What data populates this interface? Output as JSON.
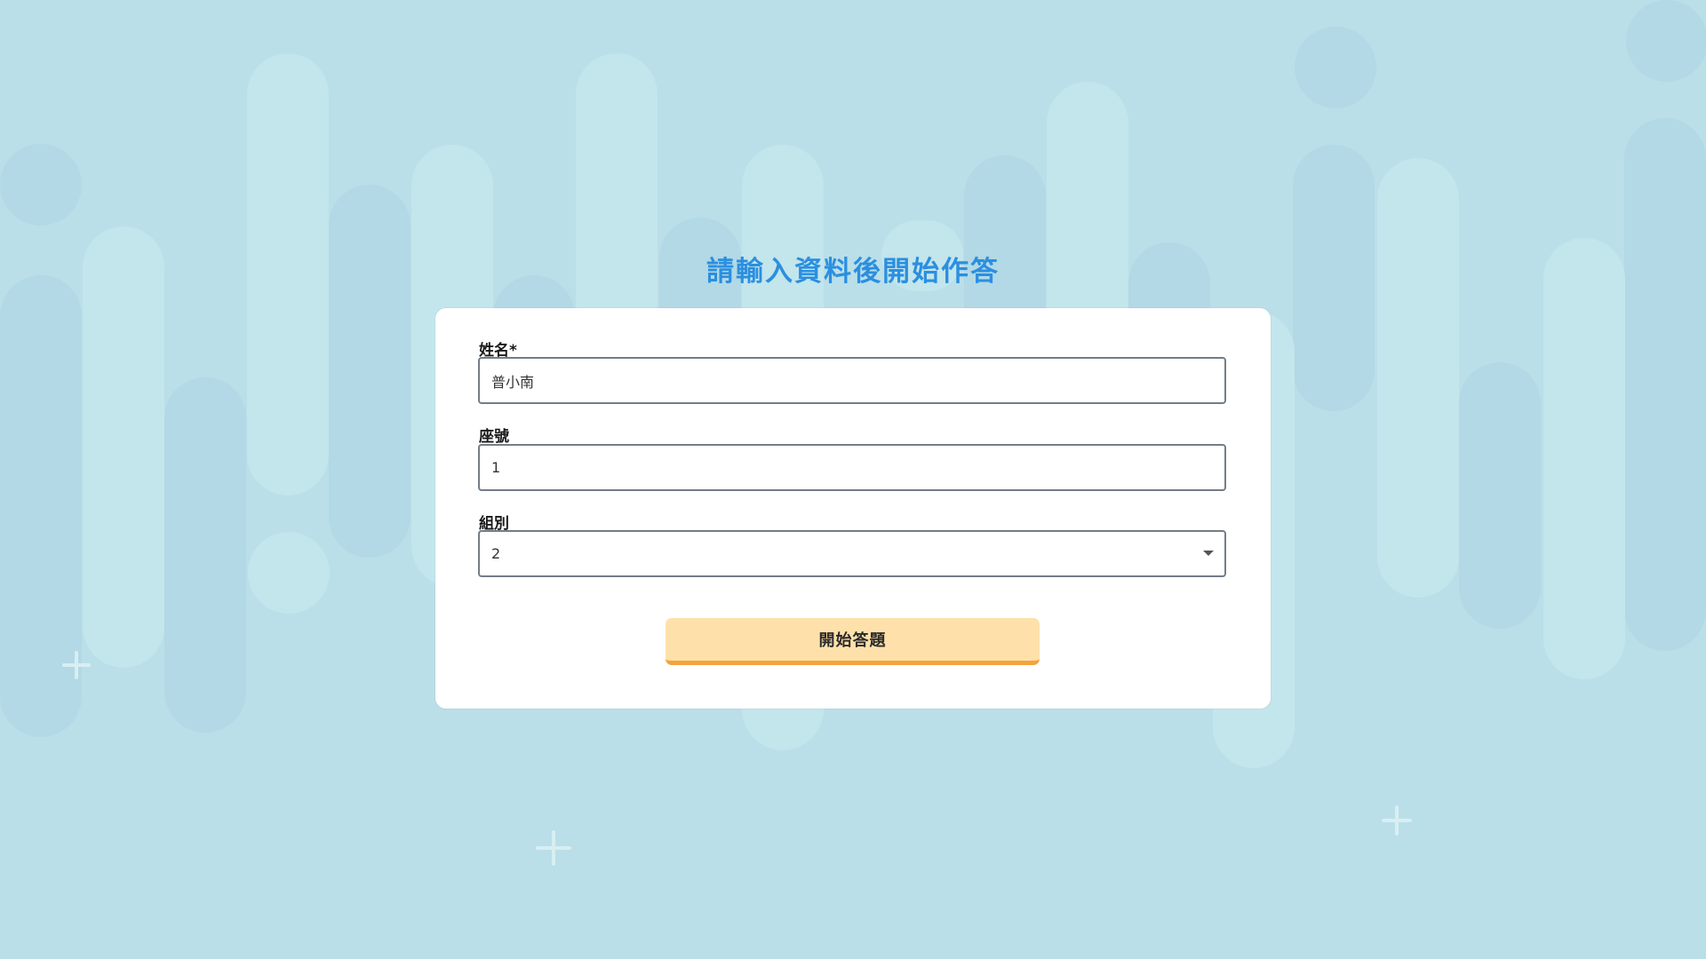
{
  "page": {
    "title": "請輸入資料後開始作答"
  },
  "form": {
    "name": {
      "label": "姓名*",
      "value": "普小南"
    },
    "seat": {
      "label": "座號",
      "value": "1"
    },
    "group": {
      "label": "組別",
      "selected": "2"
    },
    "submit_label": "開始答題"
  },
  "colors": {
    "background": "#badfe9",
    "title": "#2b8fe0",
    "button_fill": "#fee1aa",
    "button_border": "#f3a43b"
  }
}
